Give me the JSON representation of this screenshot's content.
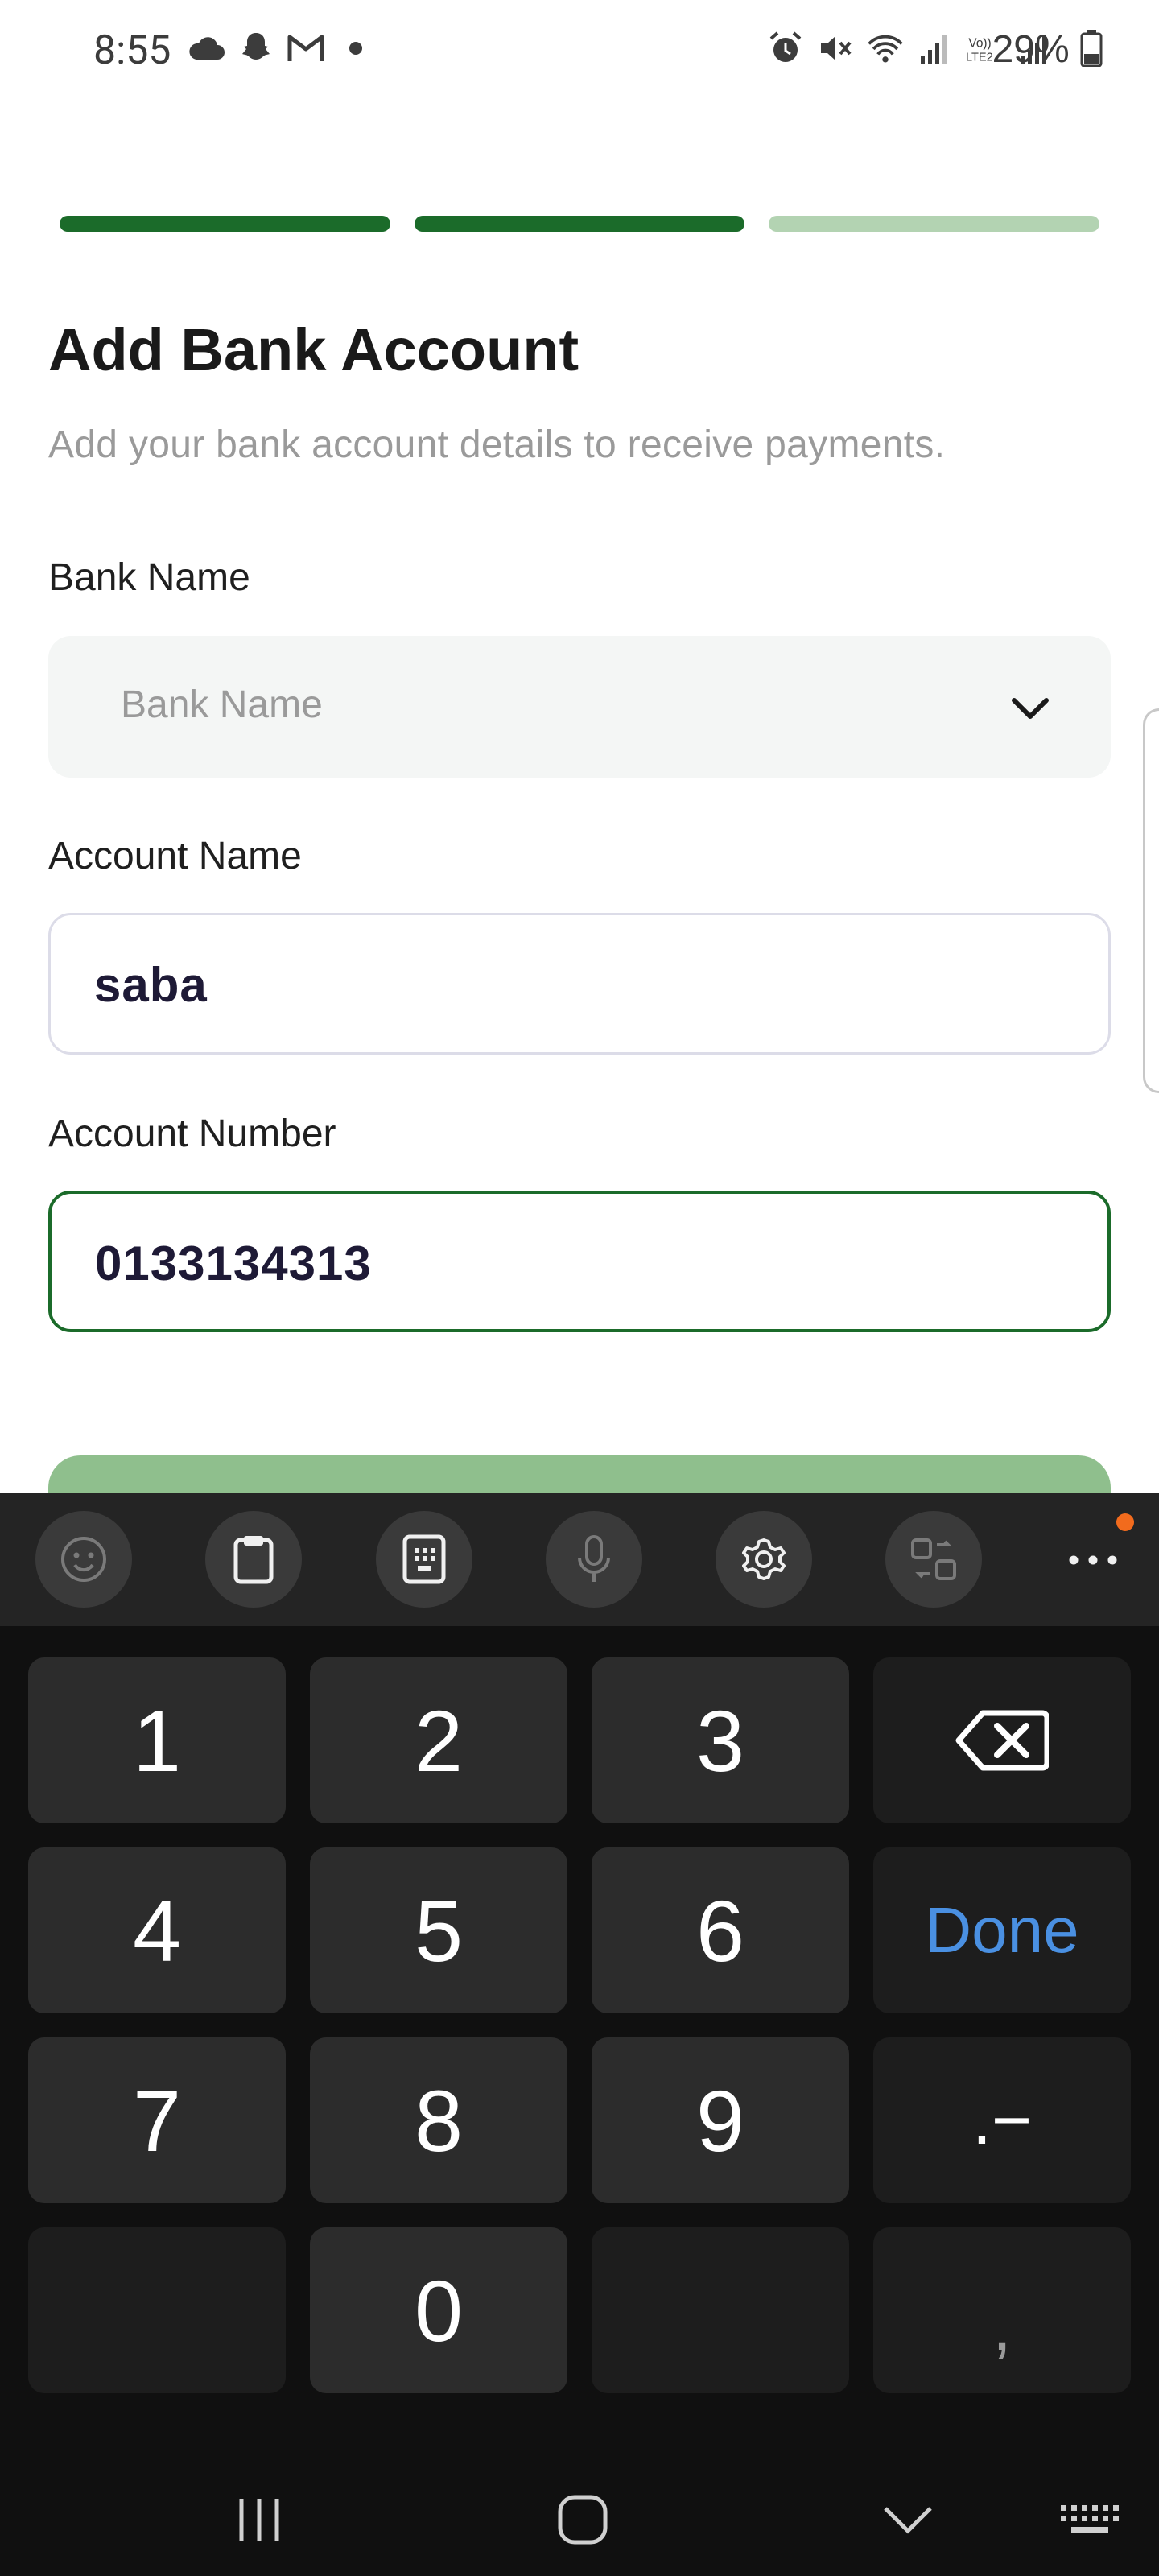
{
  "status_bar": {
    "time": "8:55",
    "battery": "29%",
    "left_icons": [
      "cloud-icon",
      "snapchat-icon",
      "gmail-icon",
      "dot-icon"
    ],
    "right_icons": [
      "alarm-icon",
      "mute-icon",
      "wifi-icon",
      "signal-icon",
      "volte-icon",
      "signal-icon",
      "battery-icon"
    ]
  },
  "progress": {
    "steps_total": 3,
    "steps_completed": 2,
    "active_color": "#1b6b2a",
    "inactive_color": "#b3d3b2"
  },
  "page": {
    "title": "Add Bank Account",
    "subtitle": "Add your bank account details to receive payments."
  },
  "form": {
    "bank_name": {
      "label": "Bank Name",
      "placeholder": "Bank Name"
    },
    "account_name": {
      "label": "Account Name",
      "value": "saba"
    },
    "account_number": {
      "label": "Account Number",
      "value": "0133134313"
    }
  },
  "keyboard": {
    "toolbar": [
      "emoji-icon",
      "clipboard-icon",
      "keypad-icon",
      "microphone-icon",
      "settings-icon",
      "translate-icon",
      "more-icon"
    ],
    "keys": {
      "k1": "1",
      "k2": "2",
      "k3": "3",
      "k4": "4",
      "k5": "5",
      "k6": "6",
      "done": "Done",
      "k7": "7",
      "k8": "8",
      "k9": "9",
      "dot_dash": ".−",
      "k0": "0",
      "comma": ","
    }
  },
  "nav_bar": [
    "recent-apps-icon",
    "home-icon",
    "back-icon",
    "keyboard-toggle-icon"
  ]
}
